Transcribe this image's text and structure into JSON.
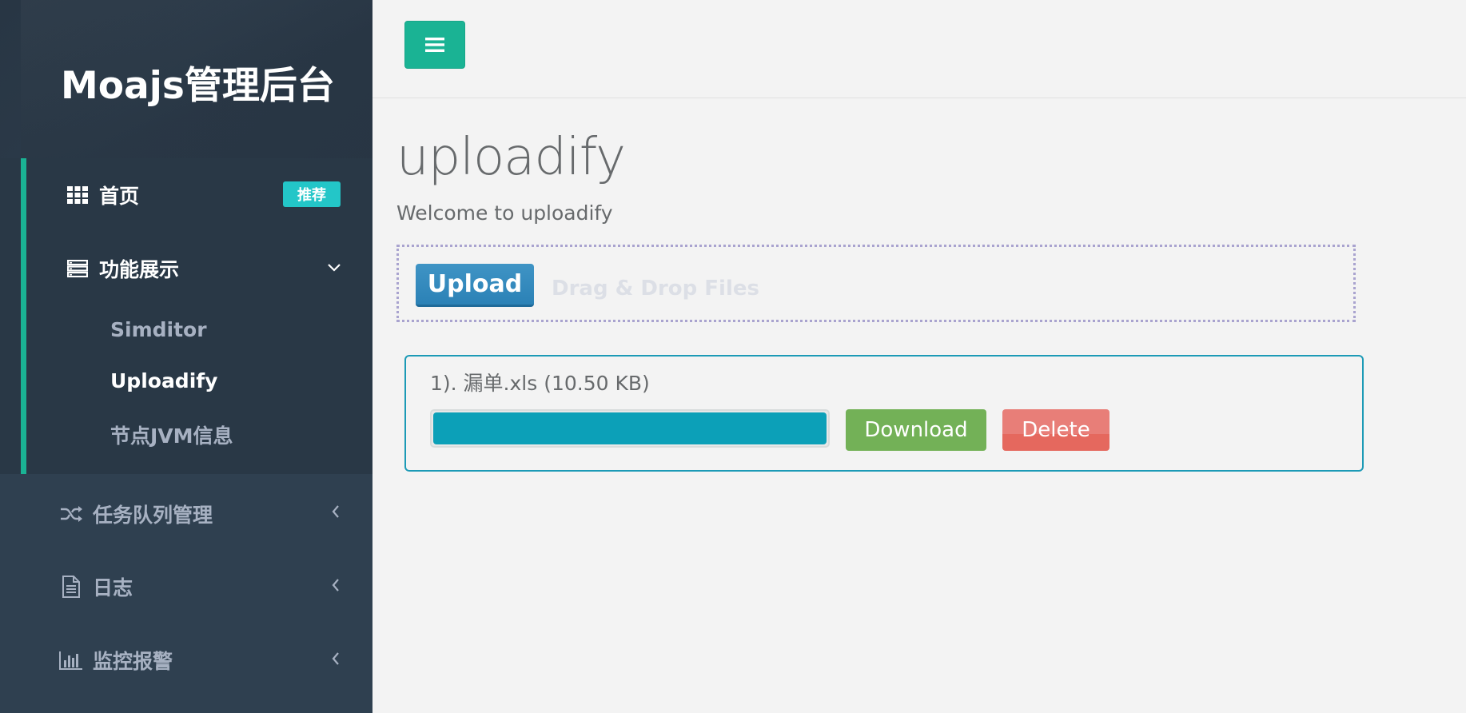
{
  "sidebar": {
    "brand": "Moajs管理后台",
    "items": [
      {
        "label": "首页",
        "icon": "grid-icon",
        "badge": "推荐"
      },
      {
        "label": "功能展示",
        "icon": "list-icon",
        "expanded": true,
        "children": [
          {
            "label": "Simditor"
          },
          {
            "label": "Uploadify",
            "current": true
          },
          {
            "label": "节点JVM信息"
          }
        ]
      },
      {
        "label": "任务队列管理",
        "icon": "shuffle-icon"
      },
      {
        "label": "日志",
        "icon": "file-text-icon"
      },
      {
        "label": "监控报警",
        "icon": "bar-chart-icon"
      }
    ]
  },
  "topbar": {
    "menu_icon": "hamburger-icon"
  },
  "main": {
    "title": "uploadify",
    "welcome": "Welcome to uploadify",
    "upload_label": "Upload",
    "drop_hint": "Drag & Drop Files",
    "file": {
      "name": "1). 漏单.xls (10.50 KB)",
      "progress_percent": 100,
      "download_label": "Download",
      "delete_label": "Delete"
    }
  },
  "colors": {
    "sidebar_bg": "#2f4050",
    "accent_green": "#1ab394",
    "badge_cyan": "#23c6c8",
    "upload_blue": "#2b81b6",
    "progress_teal": "#0ca0b8",
    "download_green": "#73b157",
    "delete_red": "#e5685e"
  }
}
